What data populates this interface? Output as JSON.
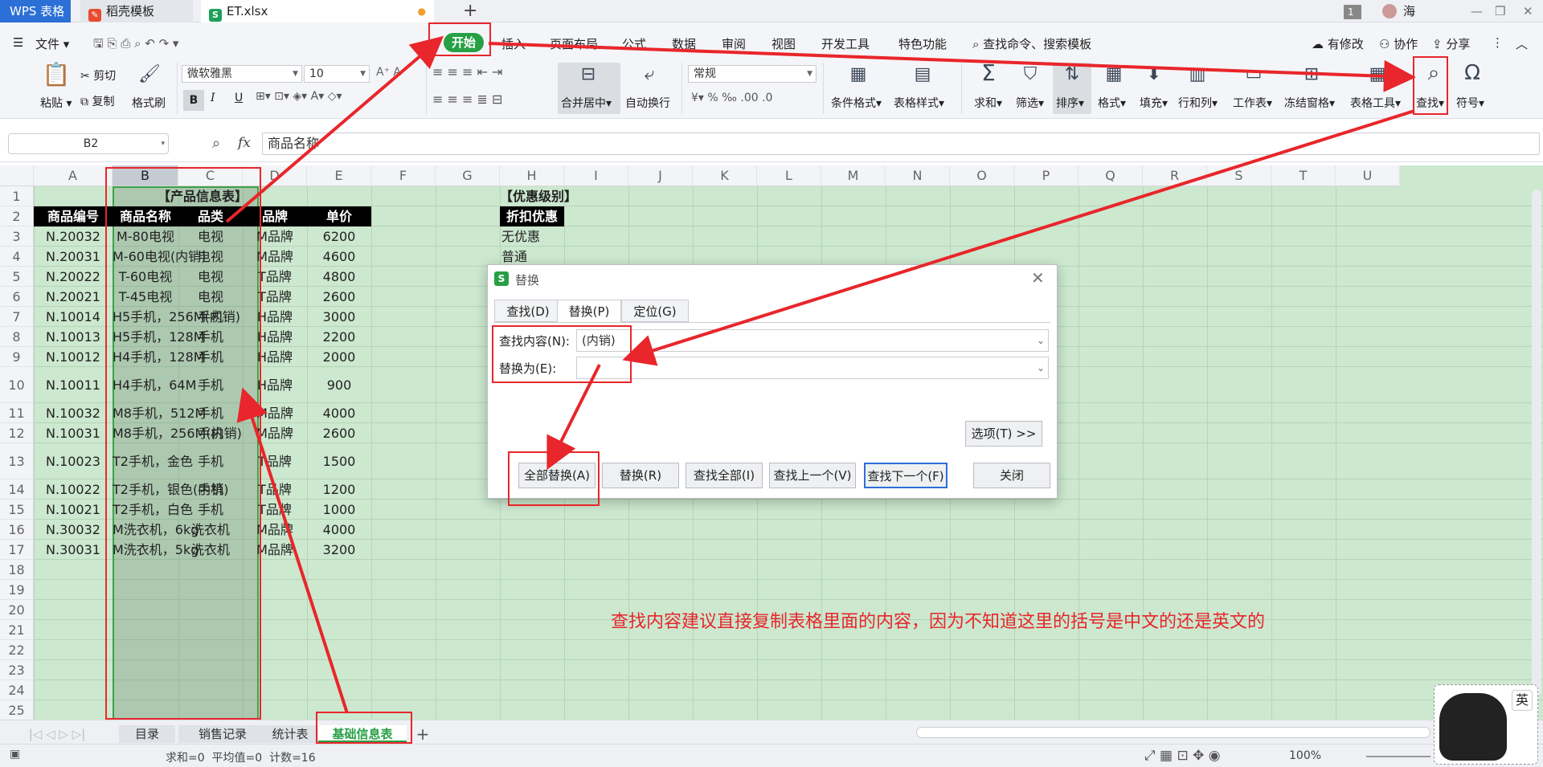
{
  "file_tabs": [
    {
      "label": "WPS 表格"
    },
    {
      "label": "稻壳模板"
    },
    {
      "label": "ET.xlsx"
    }
  ],
  "window": {
    "badge": "1",
    "user": "海"
  },
  "menu": {
    "file": "文件",
    "items": [
      "开始",
      "插入",
      "页面布局",
      "公式",
      "数据",
      "审阅",
      "视图",
      "开发工具",
      "特色功能"
    ],
    "search": "查找命令、搜索模板",
    "right": [
      "有修改",
      "协作",
      "分享"
    ]
  },
  "ribbon": {
    "paste": "粘贴",
    "cut": "剪切",
    "copy": "复制",
    "format_painter": "格式刷",
    "font_name": "微软雅黑",
    "font_size": "10",
    "merge": "合并居中",
    "wrap": "自动换行",
    "number_format": "常规",
    "cond_format": "条件格式",
    "table_style": "表格样式",
    "sum": "求和",
    "filter": "筛选",
    "sort": "排序",
    "format": "格式",
    "fill": "填充",
    "rowcol": "行和列",
    "worksheet": "工作表",
    "freeze": "冻结窗格",
    "table_tools": "表格工具",
    "find": "查找",
    "symbol": "符号"
  },
  "formula_bar": {
    "cell_ref": "B2",
    "fx": "fx",
    "content": "商品名称"
  },
  "columns": [
    "A",
    "B",
    "C",
    "D",
    "E",
    "F",
    "G",
    "H",
    "I",
    "J",
    "K",
    "L",
    "M",
    "N",
    "O",
    "P",
    "Q",
    "R",
    "S",
    "T",
    "U"
  ],
  "rows": [
    "1",
    "2",
    "3",
    "4",
    "5",
    "6",
    "7",
    "8",
    "9",
    "10",
    "11",
    "12",
    "13",
    "14",
    "15",
    "16",
    "17",
    "18",
    "19",
    "20",
    "21",
    "22",
    "23",
    "24",
    "25"
  ],
  "table": {
    "title": "【产品信息表】",
    "headers": [
      "商品编号",
      "商品名称",
      "品类",
      "品牌",
      "单价"
    ],
    "data": [
      [
        "N.20032",
        "M-80电视",
        "电视",
        "M品牌",
        "6200"
      ],
      [
        "N.20031",
        "M-60电视(内销)",
        "电视",
        "M品牌",
        "4600"
      ],
      [
        "N.20022",
        "T-60电视",
        "电视",
        "T品牌",
        "4800"
      ],
      [
        "N.20021",
        "T-45电视",
        "电视",
        "T品牌",
        "2600"
      ],
      [
        "N.10014",
        "H5手机，256M(内销)",
        "手机",
        "H品牌",
        "3000"
      ],
      [
        "N.10013",
        "H5手机，128M",
        "手机",
        "H品牌",
        "2200"
      ],
      [
        "N.10012",
        "H4手机，128M",
        "手机",
        "H品牌",
        "2000"
      ],
      [
        "N.10011",
        "H4手机，64M",
        "手机",
        "H品牌",
        "900"
      ],
      [
        "N.10032",
        "M8手机，512M",
        "手机",
        "M品牌",
        "4000"
      ],
      [
        "N.10031",
        "M8手机，256M(内销)",
        "手机",
        "M品牌",
        "2600"
      ],
      [
        "N.10023",
        "T2手机，金色",
        "手机",
        "T品牌",
        "1500"
      ],
      [
        "N.10022",
        "T2手机，银色(内销)",
        "手机",
        "T品牌",
        "1200"
      ],
      [
        "N.10021",
        "T2手机，白色",
        "手机",
        "T品牌",
        "1000"
      ],
      [
        "N.30032",
        "M洗衣机，6kg",
        "洗衣机",
        "M品牌",
        "4000"
      ],
      [
        "N.30031",
        "M洗衣机，5kg",
        "洗衣机",
        "M品牌",
        "3200"
      ]
    ]
  },
  "discount": {
    "title": "【优惠级别】",
    "header": "折扣优惠",
    "items": [
      "无优惠",
      "普通"
    ]
  },
  "annotation": "查找内容建议直接复制表格里面的内容，因为不知道这里的括号是中文的还是英文的",
  "sheets": [
    "目录",
    "销售记录",
    "统计表",
    "基础信息表"
  ],
  "status": {
    "text": "求和=0  平均值=0  计数=16",
    "zoom": "100%"
  },
  "dialog": {
    "title": "替换",
    "tabs": [
      "查找(D)",
      "替换(P)",
      "定位(G)"
    ],
    "find_label": "查找内容(N):",
    "find_value": "(内销)",
    "replace_label": "替换为(E):",
    "replace_value": "",
    "options": "选项(T) >>",
    "buttons": [
      "全部替换(A)",
      "替换(R)",
      "查找全部(I)",
      "查找上一个(V)",
      "查找下一个(F)",
      "关闭"
    ]
  },
  "ime": {
    "label": "英"
  },
  "colors": {
    "accent": "#27a045",
    "highlight_red": "#e8262b",
    "sheet_bg": "#cce8cf"
  }
}
